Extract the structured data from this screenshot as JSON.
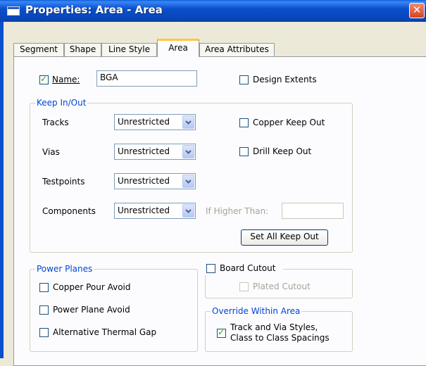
{
  "window": {
    "title": "Properties: Area - Area",
    "close_label": "✕"
  },
  "tabs": [
    {
      "label": "Segment",
      "active": false
    },
    {
      "label": "Shape",
      "active": false
    },
    {
      "label": "Line Style",
      "active": false
    },
    {
      "label": "Area",
      "active": true
    },
    {
      "label": "Area Attributes",
      "active": false
    }
  ],
  "area": {
    "name_label": "Name:",
    "name_checked": true,
    "name_value": "BGA",
    "design_extents_label": "Design Extents",
    "design_extents_checked": false
  },
  "keep_in_out": {
    "title": "Keep In/Out",
    "rows": [
      {
        "label": "Tracks",
        "value": "Unrestricted"
      },
      {
        "label": "Vias",
        "value": "Unrestricted"
      },
      {
        "label": "Testpoints",
        "value": "Unrestricted"
      },
      {
        "label": "Components",
        "value": "Unrestricted"
      }
    ],
    "copper_keep_out_label": "Copper  Keep Out",
    "copper_keep_out_checked": false,
    "drill_keep_out_label": "Drill  Keep Out",
    "drill_keep_out_checked": false,
    "if_higher_than_label": "If Higher Than:",
    "if_higher_than_value": "",
    "set_all_button": "Set All Keep Out"
  },
  "power_planes": {
    "title": "Power Planes",
    "items": [
      {
        "label": "Copper Pour Avoid",
        "checked": false
      },
      {
        "label": "Power Plane Avoid",
        "checked": false
      },
      {
        "label": "Alternative Thermal Gap",
        "checked": false
      }
    ]
  },
  "board_cutout": {
    "label": "Board Cutout",
    "checked": false,
    "plated_label": "Plated Cutout",
    "plated_checked": false
  },
  "override": {
    "title": "Override Within Area",
    "label_line1": "Track and Via Styles,",
    "label_line2": "Class to Class Spacings",
    "checked": true
  },
  "colors": {
    "title_bar": "#0a4fcc",
    "group_title": "#0046d5",
    "active_tab_accent": "#ffc83c",
    "close_button": "#d8431e",
    "check_mark": "#21a121"
  }
}
